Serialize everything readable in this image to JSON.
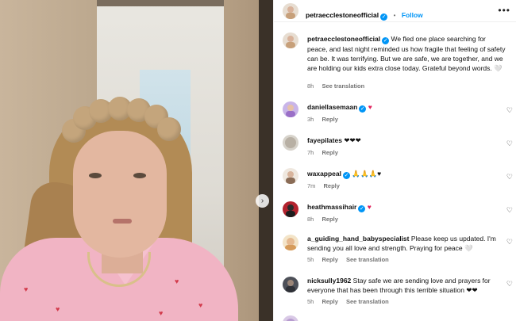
{
  "post": {
    "username": "petraecclestoneofficial",
    "follow_label": "Follow",
    "separator": "•",
    "caption": "We fled one place searching for peace, and last night reminded us how fragile that feeling of safety can be. It was terrifying. But we are safe, we are together, and we are holding our kids extra close today. Grateful beyond words. 🤍",
    "time": "8h",
    "see_translation": "See translation"
  },
  "comments": [
    {
      "username": "daniellasemaan",
      "text": "♥",
      "time": "3h",
      "reply": "Reply"
    },
    {
      "username": "fayepilates",
      "text": "❤❤❤",
      "time": "7h",
      "reply": "Reply"
    },
    {
      "username": "waxappeal",
      "text": "🙏🙏🙏♥",
      "time": "7m",
      "reply": "Reply"
    },
    {
      "username": "heathmassihair",
      "text": "♥",
      "time": "8h",
      "reply": "Reply"
    },
    {
      "username": "a_guiding_hand_babyspecialist",
      "text": "Please keep us updated. I'm sending you all love and strength. Praying for peace 🤍",
      "time": "5h",
      "reply": "Reply",
      "see_translation": "See translation"
    },
    {
      "username": "nicksully1962",
      "text": "Stay safe we are sending love and prayers for everyone that has been through this terrible situation ❤❤",
      "time": "5h",
      "reply": "Reply",
      "see_translation": "See translation"
    }
  ],
  "icons": {
    "more": "more-options-icon",
    "like": "heart-outline-icon",
    "next": "chevron-right-icon"
  },
  "colors": {
    "accent": "#0095f6",
    "heart_red": "#e0245e",
    "meta_gray": "#737373"
  }
}
